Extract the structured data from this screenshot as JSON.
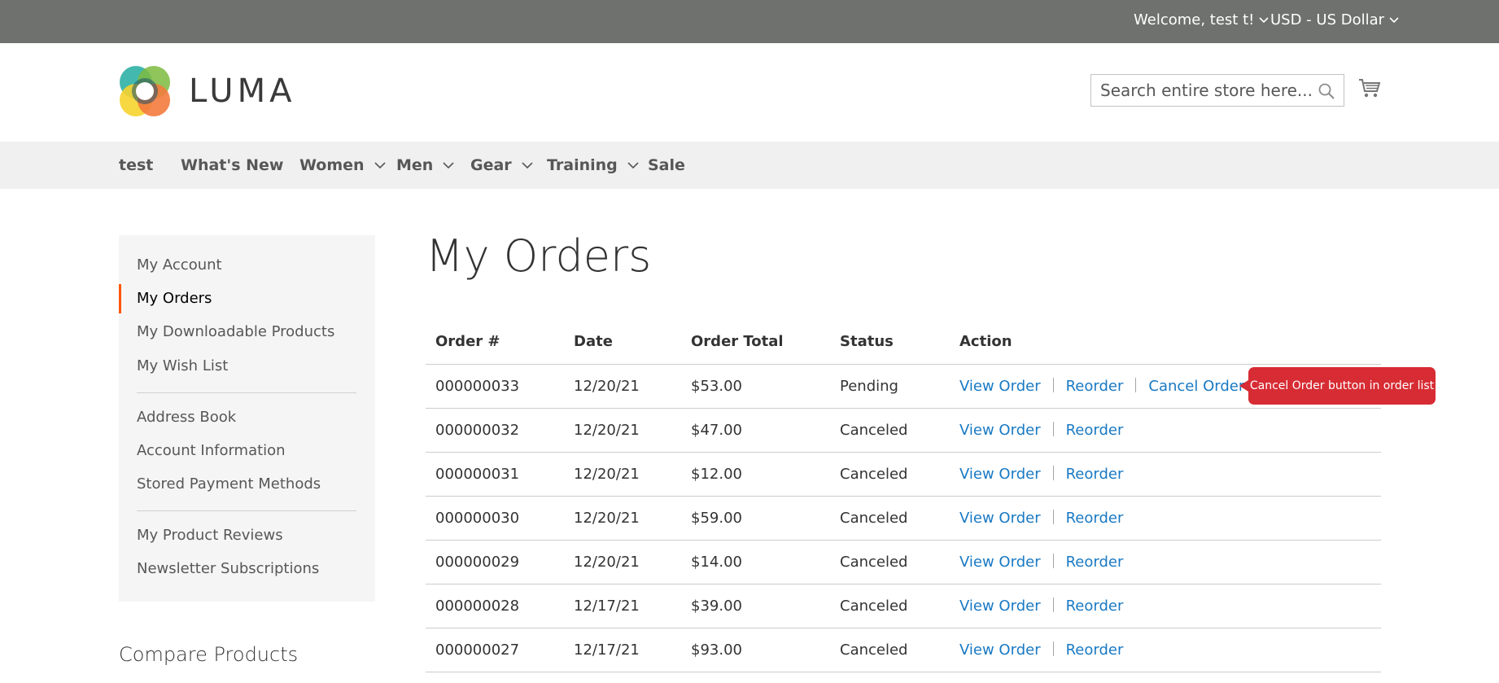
{
  "top_bar": {
    "welcome": "Welcome, test t!",
    "currency": "USD - US Dollar",
    "bg_color": "#6e716e"
  },
  "header": {
    "logo_text": "LUMA",
    "search_placeholder": "Search entire store here...",
    "icons": {
      "search": "search-icon",
      "cart": "cart-icon"
    }
  },
  "nav": {
    "items": [
      {
        "label": "test",
        "dropdown": false
      },
      {
        "label": "What's New",
        "dropdown": false
      },
      {
        "label": "Women",
        "dropdown": true
      },
      {
        "label": "Men",
        "dropdown": true
      },
      {
        "label": "Gear",
        "dropdown": true
      },
      {
        "label": "Training",
        "dropdown": true
      },
      {
        "label": "Sale",
        "dropdown": false
      }
    ]
  },
  "sidebar": {
    "items": [
      {
        "label": "My Account"
      },
      {
        "label": "My Orders",
        "active": true
      },
      {
        "label": "My Downloadable Products"
      },
      {
        "label": "My Wish List"
      },
      {
        "label": "Address Book"
      },
      {
        "label": "Account Information"
      },
      {
        "label": "Stored Payment Methods"
      },
      {
        "label": "My Product Reviews"
      },
      {
        "label": "Newsletter Subscriptions"
      }
    ],
    "active_color": "#ff5501"
  },
  "compare": {
    "title": "Compare Products"
  },
  "main": {
    "title": "My Orders",
    "columns": [
      "Order #",
      "Date",
      "Order Total",
      "Status",
      "Action"
    ],
    "orders": [
      {
        "number": "000000033",
        "date": "12/20/21",
        "total": "$53.00",
        "status": "Pending",
        "view": "View Order",
        "reorder": "Reorder",
        "cancel": "Cancel Order"
      },
      {
        "number": "000000032",
        "date": "12/20/21",
        "total": "$47.00",
        "status": "Canceled",
        "view": "View Order",
        "reorder": "Reorder"
      },
      {
        "number": "000000031",
        "date": "12/20/21",
        "total": "$12.00",
        "status": "Canceled",
        "view": "View Order",
        "reorder": "Reorder"
      },
      {
        "number": "000000030",
        "date": "12/20/21",
        "total": "$59.00",
        "status": "Canceled",
        "view": "View Order",
        "reorder": "Reorder"
      },
      {
        "number": "000000029",
        "date": "12/20/21",
        "total": "$14.00",
        "status": "Canceled",
        "view": "View Order",
        "reorder": "Reorder"
      },
      {
        "number": "000000028",
        "date": "12/17/21",
        "total": "$39.00",
        "status": "Canceled",
        "view": "View Order",
        "reorder": "Reorder"
      },
      {
        "number": "000000027",
        "date": "12/17/21",
        "total": "$93.00",
        "status": "Canceled",
        "view": "View Order",
        "reorder": "Reorder"
      }
    ],
    "link_color": "#1979c3"
  },
  "tooltip": {
    "text": "Cancel Order button in order list",
    "color": "#d72c34"
  }
}
